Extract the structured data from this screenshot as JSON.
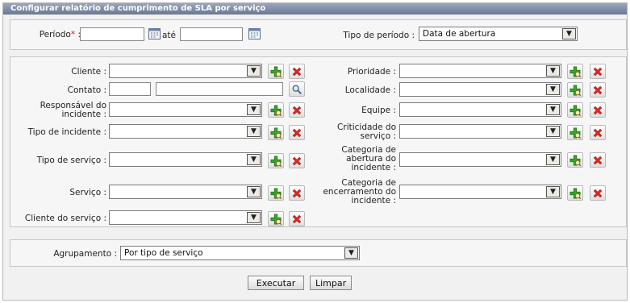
{
  "window": {
    "title": "Configurar relatório de cumprimento de SLA por serviço"
  },
  "period": {
    "label": "Período",
    "required_mark": "*",
    "colon": ":",
    "start_value": "",
    "end_value": "",
    "until_label": "até",
    "type_label": "Tipo de período :",
    "type_value": "Data de abertura"
  },
  "left_fields": {
    "cliente": "Cliente :",
    "contato": "Contato :",
    "responsavel_1": "Responsável do",
    "responsavel_2": "incidente :",
    "tipo_incidente": "Tipo de incidente :",
    "tipo_servico": "Tipo de serviço :",
    "servico": "Serviço :",
    "cliente_servico": "Cliente do serviço :"
  },
  "right_fields": {
    "prioridade": "Prioridade :",
    "localidade": "Localidade :",
    "equipe": "Equipe :",
    "criticidade_1": "Criticidade do",
    "criticidade_2": "serviço :",
    "cat_abertura_1": "Categoria de",
    "cat_abertura_2": "abertura do",
    "cat_abertura_3": "incidente :",
    "cat_encerramento_1": "Categoria de",
    "cat_encerramento_2": "encerramento do",
    "cat_encerramento_3": "incidente :"
  },
  "grouping": {
    "label": "Agrupamento :",
    "value": "Por tipo de serviço"
  },
  "actions": {
    "run": "Executar",
    "clear": "Limpar"
  },
  "icons": {
    "add": "add-search-icon",
    "remove": "remove-x-icon",
    "calendar": "calendar-icon",
    "search": "magnifier-icon",
    "dropdown": "chevron-down-icon"
  },
  "colors": {
    "titlebar": "#7b88a2",
    "add_icon": "#2e9a1e",
    "remove_icon": "#d9221b",
    "required": "#dd1111"
  }
}
